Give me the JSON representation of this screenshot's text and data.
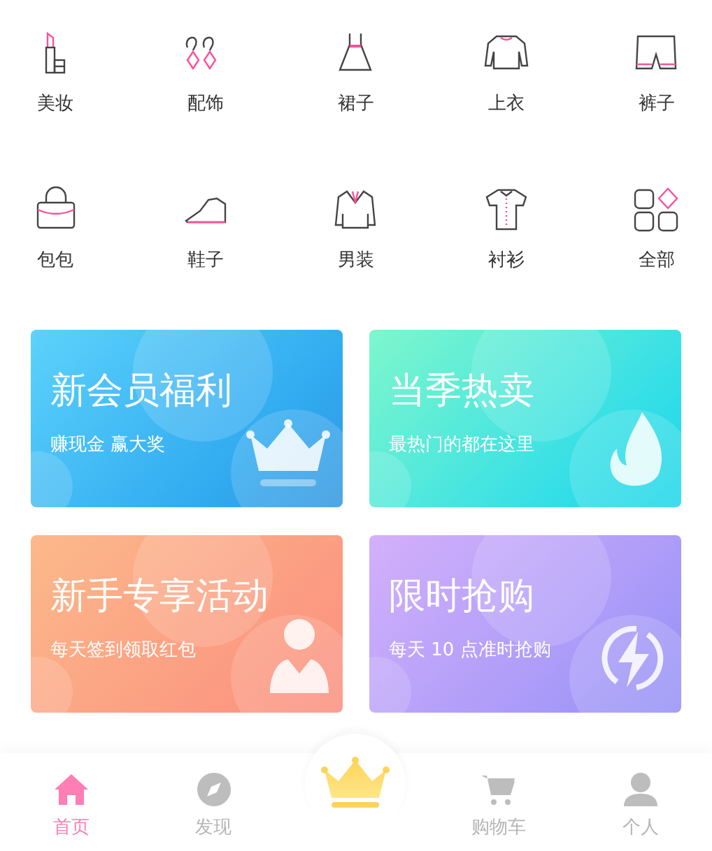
{
  "categories": [
    {
      "kind": "lipstick",
      "label": "美妆"
    },
    {
      "kind": "earrings",
      "label": "配饰"
    },
    {
      "kind": "dress",
      "label": "裙子"
    },
    {
      "kind": "sweater",
      "label": "上衣"
    },
    {
      "kind": "shorts",
      "label": "裤子"
    },
    {
      "kind": "bag",
      "label": "包包"
    },
    {
      "kind": "shoe",
      "label": "鞋子"
    },
    {
      "kind": "coat",
      "label": "男装"
    },
    {
      "kind": "shirt",
      "label": "衬衫"
    },
    {
      "kind": "grid",
      "label": "全部"
    }
  ],
  "promos": [
    {
      "kind": "crown",
      "title": "新会员福利",
      "subtitle": "赚现金 赢大奖"
    },
    {
      "kind": "flame",
      "title": "当季热卖",
      "subtitle": "最热门的都在这里"
    },
    {
      "kind": "person",
      "title": "新手专享活动",
      "subtitle": "每天签到领取红包"
    },
    {
      "kind": "bolt",
      "title": "限时抢购",
      "subtitle": "每天 10 点准时抢购"
    }
  ],
  "tab_bar": [
    {
      "kind": "home",
      "label": "首页",
      "selected": true
    },
    {
      "kind": "compass",
      "label": "发现",
      "selected": false
    },
    {
      "kind": "crown",
      "selected": false
    },
    {
      "kind": "cart",
      "label": "购物车",
      "selected": false
    },
    {
      "kind": "person",
      "label": "个人",
      "selected": false
    }
  ]
}
